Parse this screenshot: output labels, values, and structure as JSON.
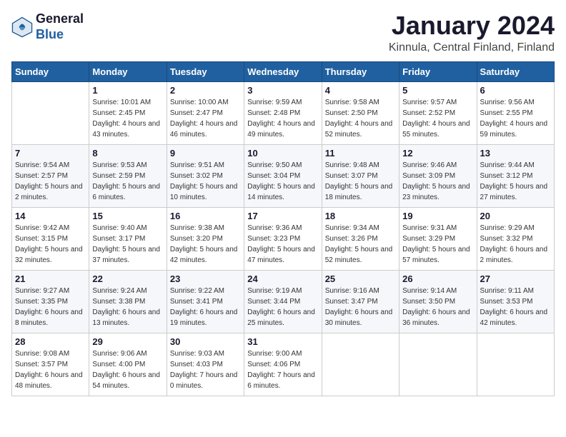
{
  "header": {
    "logo_general": "General",
    "logo_blue": "Blue",
    "month_title": "January 2024",
    "location": "Kinnula, Central Finland, Finland"
  },
  "days_of_week": [
    "Sunday",
    "Monday",
    "Tuesday",
    "Wednesday",
    "Thursday",
    "Friday",
    "Saturday"
  ],
  "weeks": [
    [
      {
        "day": "",
        "sunrise": "",
        "sunset": "",
        "daylight": ""
      },
      {
        "day": "1",
        "sunrise": "Sunrise: 10:01 AM",
        "sunset": "Sunset: 2:45 PM",
        "daylight": "Daylight: 4 hours and 43 minutes."
      },
      {
        "day": "2",
        "sunrise": "Sunrise: 10:00 AM",
        "sunset": "Sunset: 2:47 PM",
        "daylight": "Daylight: 4 hours and 46 minutes."
      },
      {
        "day": "3",
        "sunrise": "Sunrise: 9:59 AM",
        "sunset": "Sunset: 2:48 PM",
        "daylight": "Daylight: 4 hours and 49 minutes."
      },
      {
        "day": "4",
        "sunrise": "Sunrise: 9:58 AM",
        "sunset": "Sunset: 2:50 PM",
        "daylight": "Daylight: 4 hours and 52 minutes."
      },
      {
        "day": "5",
        "sunrise": "Sunrise: 9:57 AM",
        "sunset": "Sunset: 2:52 PM",
        "daylight": "Daylight: 4 hours and 55 minutes."
      },
      {
        "day": "6",
        "sunrise": "Sunrise: 9:56 AM",
        "sunset": "Sunset: 2:55 PM",
        "daylight": "Daylight: 4 hours and 59 minutes."
      }
    ],
    [
      {
        "day": "7",
        "sunrise": "Sunrise: 9:54 AM",
        "sunset": "Sunset: 2:57 PM",
        "daylight": "Daylight: 5 hours and 2 minutes."
      },
      {
        "day": "8",
        "sunrise": "Sunrise: 9:53 AM",
        "sunset": "Sunset: 2:59 PM",
        "daylight": "Daylight: 5 hours and 6 minutes."
      },
      {
        "day": "9",
        "sunrise": "Sunrise: 9:51 AM",
        "sunset": "Sunset: 3:02 PM",
        "daylight": "Daylight: 5 hours and 10 minutes."
      },
      {
        "day": "10",
        "sunrise": "Sunrise: 9:50 AM",
        "sunset": "Sunset: 3:04 PM",
        "daylight": "Daylight: 5 hours and 14 minutes."
      },
      {
        "day": "11",
        "sunrise": "Sunrise: 9:48 AM",
        "sunset": "Sunset: 3:07 PM",
        "daylight": "Daylight: 5 hours and 18 minutes."
      },
      {
        "day": "12",
        "sunrise": "Sunrise: 9:46 AM",
        "sunset": "Sunset: 3:09 PM",
        "daylight": "Daylight: 5 hours and 23 minutes."
      },
      {
        "day": "13",
        "sunrise": "Sunrise: 9:44 AM",
        "sunset": "Sunset: 3:12 PM",
        "daylight": "Daylight: 5 hours and 27 minutes."
      }
    ],
    [
      {
        "day": "14",
        "sunrise": "Sunrise: 9:42 AM",
        "sunset": "Sunset: 3:15 PM",
        "daylight": "Daylight: 5 hours and 32 minutes."
      },
      {
        "day": "15",
        "sunrise": "Sunrise: 9:40 AM",
        "sunset": "Sunset: 3:17 PM",
        "daylight": "Daylight: 5 hours and 37 minutes."
      },
      {
        "day": "16",
        "sunrise": "Sunrise: 9:38 AM",
        "sunset": "Sunset: 3:20 PM",
        "daylight": "Daylight: 5 hours and 42 minutes."
      },
      {
        "day": "17",
        "sunrise": "Sunrise: 9:36 AM",
        "sunset": "Sunset: 3:23 PM",
        "daylight": "Daylight: 5 hours and 47 minutes."
      },
      {
        "day": "18",
        "sunrise": "Sunrise: 9:34 AM",
        "sunset": "Sunset: 3:26 PM",
        "daylight": "Daylight: 5 hours and 52 minutes."
      },
      {
        "day": "19",
        "sunrise": "Sunrise: 9:31 AM",
        "sunset": "Sunset: 3:29 PM",
        "daylight": "Daylight: 5 hours and 57 minutes."
      },
      {
        "day": "20",
        "sunrise": "Sunrise: 9:29 AM",
        "sunset": "Sunset: 3:32 PM",
        "daylight": "Daylight: 6 hours and 2 minutes."
      }
    ],
    [
      {
        "day": "21",
        "sunrise": "Sunrise: 9:27 AM",
        "sunset": "Sunset: 3:35 PM",
        "daylight": "Daylight: 6 hours and 8 minutes."
      },
      {
        "day": "22",
        "sunrise": "Sunrise: 9:24 AM",
        "sunset": "Sunset: 3:38 PM",
        "daylight": "Daylight: 6 hours and 13 minutes."
      },
      {
        "day": "23",
        "sunrise": "Sunrise: 9:22 AM",
        "sunset": "Sunset: 3:41 PM",
        "daylight": "Daylight: 6 hours and 19 minutes."
      },
      {
        "day": "24",
        "sunrise": "Sunrise: 9:19 AM",
        "sunset": "Sunset: 3:44 PM",
        "daylight": "Daylight: 6 hours and 25 minutes."
      },
      {
        "day": "25",
        "sunrise": "Sunrise: 9:16 AM",
        "sunset": "Sunset: 3:47 PM",
        "daylight": "Daylight: 6 hours and 30 minutes."
      },
      {
        "day": "26",
        "sunrise": "Sunrise: 9:14 AM",
        "sunset": "Sunset: 3:50 PM",
        "daylight": "Daylight: 6 hours and 36 minutes."
      },
      {
        "day": "27",
        "sunrise": "Sunrise: 9:11 AM",
        "sunset": "Sunset: 3:53 PM",
        "daylight": "Daylight: 6 hours and 42 minutes."
      }
    ],
    [
      {
        "day": "28",
        "sunrise": "Sunrise: 9:08 AM",
        "sunset": "Sunset: 3:57 PM",
        "daylight": "Daylight: 6 hours and 48 minutes."
      },
      {
        "day": "29",
        "sunrise": "Sunrise: 9:06 AM",
        "sunset": "Sunset: 4:00 PM",
        "daylight": "Daylight: 6 hours and 54 minutes."
      },
      {
        "day": "30",
        "sunrise": "Sunrise: 9:03 AM",
        "sunset": "Sunset: 4:03 PM",
        "daylight": "Daylight: 7 hours and 0 minutes."
      },
      {
        "day": "31",
        "sunrise": "Sunrise: 9:00 AM",
        "sunset": "Sunset: 4:06 PM",
        "daylight": "Daylight: 7 hours and 6 minutes."
      },
      {
        "day": "",
        "sunrise": "",
        "sunset": "",
        "daylight": ""
      },
      {
        "day": "",
        "sunrise": "",
        "sunset": "",
        "daylight": ""
      },
      {
        "day": "",
        "sunrise": "",
        "sunset": "",
        "daylight": ""
      }
    ]
  ]
}
